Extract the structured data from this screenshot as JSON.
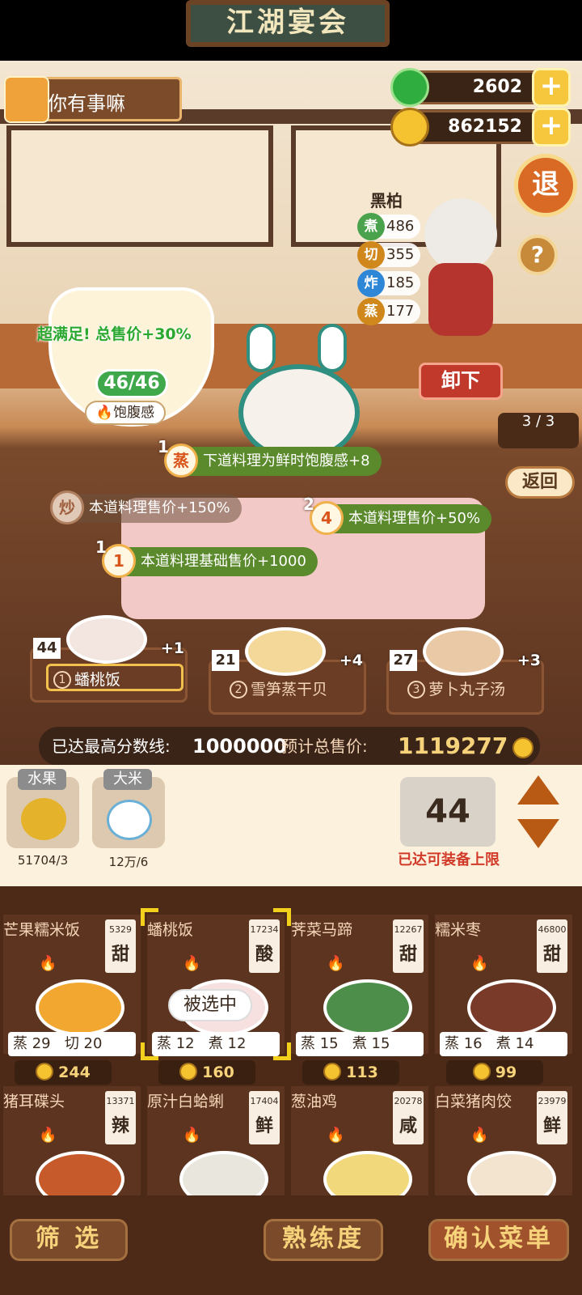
{
  "header": {
    "title": "江湖宴会",
    "player_name": "你有事嘛",
    "jade": "2602",
    "coins": "862152",
    "exit_label": "退",
    "help_label": "?"
  },
  "chef": {
    "name": "黑柏",
    "stats": [
      {
        "skill": "煮",
        "value": "486",
        "color": "#4aa34c"
      },
      {
        "skill": "切",
        "value": "355",
        "color": "#d0881c"
      },
      {
        "skill": "炸",
        "value": "185",
        "color": "#2e86d6"
      },
      {
        "skill": "蒸",
        "value": "177",
        "color": "#d0881c"
      }
    ],
    "unload_label": "卸下"
  },
  "progress": "3 / 3",
  "back_label": "返回",
  "satisfaction": {
    "bonus_text": "超满足! 总售价+30%",
    "count": "46/46",
    "label": "饱腹感"
  },
  "buffs": [
    {
      "num": "1",
      "icon": "蒸",
      "text": "下道料理为鲜时饱腹感+8"
    },
    {
      "num": "",
      "icon": "炒",
      "text": "本道料理售价+150%"
    },
    {
      "num": "2",
      "icon": "4",
      "text": "本道料理售价+50%"
    },
    {
      "num": "1",
      "icon": "1",
      "text": "本道料理基础售价+1000"
    }
  ],
  "menu_slots": [
    {
      "idx": "1",
      "count": "44",
      "plus": "+1",
      "name": "蟠桃饭"
    },
    {
      "idx": "2",
      "count": "21",
      "plus": "+4",
      "name": "雪笋蒸干贝"
    },
    {
      "idx": "3",
      "count": "27",
      "plus": "+3",
      "name": "萝卜丸子汤"
    }
  ],
  "score": {
    "max_label": "已达最高分数线:",
    "max_value": "1000000",
    "total_label": "预计总售价:",
    "total_value": "1119277"
  },
  "ingredients": [
    {
      "tag": "水果",
      "value": "51704/3"
    },
    {
      "tag": "大米",
      "value": "12万/6"
    }
  ],
  "quantity": {
    "value": "44",
    "limit_text": "已达可装备上限"
  },
  "dishes": [
    {
      "name": "芒果糯米饭",
      "num": "5329",
      "taste": "甜",
      "s1": "蒸",
      "v1": "29",
      "s2": "切",
      "v2": "20",
      "price": "244"
    },
    {
      "name": "蟠桃饭",
      "num": "17234",
      "taste": "酸",
      "s1": "蒸",
      "v1": "12",
      "s2": "煮",
      "v2": "12",
      "price": "160"
    },
    {
      "name": "荠菜马蹄",
      "num": "12267",
      "taste": "甜",
      "s1": "蒸",
      "v1": "15",
      "s2": "煮",
      "v2": "15",
      "price": "113"
    },
    {
      "name": "糯米枣",
      "num": "46800",
      "taste": "甜",
      "s1": "蒸",
      "v1": "16",
      "s2": "煮",
      "v2": "14",
      "price": "99"
    },
    {
      "name": "猪耳碟头",
      "num": "13371",
      "taste": "辣"
    },
    {
      "name": "原汁白蛤蜊",
      "num": "17404",
      "taste": "鲜"
    },
    {
      "name": "葱油鸡",
      "num": "20278",
      "taste": "咸"
    },
    {
      "name": "白菜猪肉饺",
      "num": "23979",
      "taste": "鲜"
    }
  ],
  "selected_label": "被选中",
  "toolbar": {
    "filter": "筛 选",
    "proficiency": "熟练度",
    "confirm": "确认菜单"
  }
}
